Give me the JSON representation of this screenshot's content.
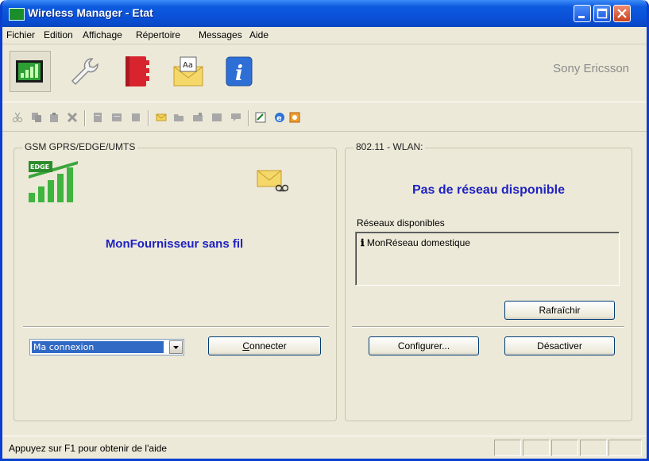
{
  "window": {
    "title": "Wireless Manager - Etat"
  },
  "menu": [
    "Fichier",
    "Edition",
    "Affichage",
    "Répertoire",
    "Messages",
    "Aide"
  ],
  "toolbar": {
    "big_icons": [
      "signal-status-icon",
      "wrench-icon",
      "red-book-icon",
      "envelope-aa-icon",
      "info-icon"
    ],
    "brand": "Sony Ericsson",
    "small_icons": [
      "cut-icon",
      "copy-icon",
      "paste-icon",
      "delete-icon",
      "doc-icon",
      "doc2-icon",
      "doc3-icon",
      "envelope-icon",
      "folder-icon",
      "folder2-icon",
      "folder3-icon",
      "comment-icon",
      "edit-icon",
      "browser-icon",
      "settings-icon"
    ]
  },
  "gsm": {
    "title": "GSM GPRS/EDGE/UMTS",
    "edge_badge": "EDGE",
    "provider": "MonFournisseur sans fil",
    "connection_value": "Ma connexion",
    "connect_label": "Connecter",
    "connect_underline": "C"
  },
  "wlan": {
    "title": "802.11 - WLAN:",
    "status": "Pas de réseau disponible",
    "available_label": "Réseaux disponibles",
    "networks": [
      "MonRéseau domestique"
    ],
    "refresh_label": "Rafraîchir",
    "configure_label": "Configurer...",
    "disable_label": "Désactiver"
  },
  "statusbar": {
    "text": "Appuyez sur F1 pour obtenir de l'aide"
  }
}
